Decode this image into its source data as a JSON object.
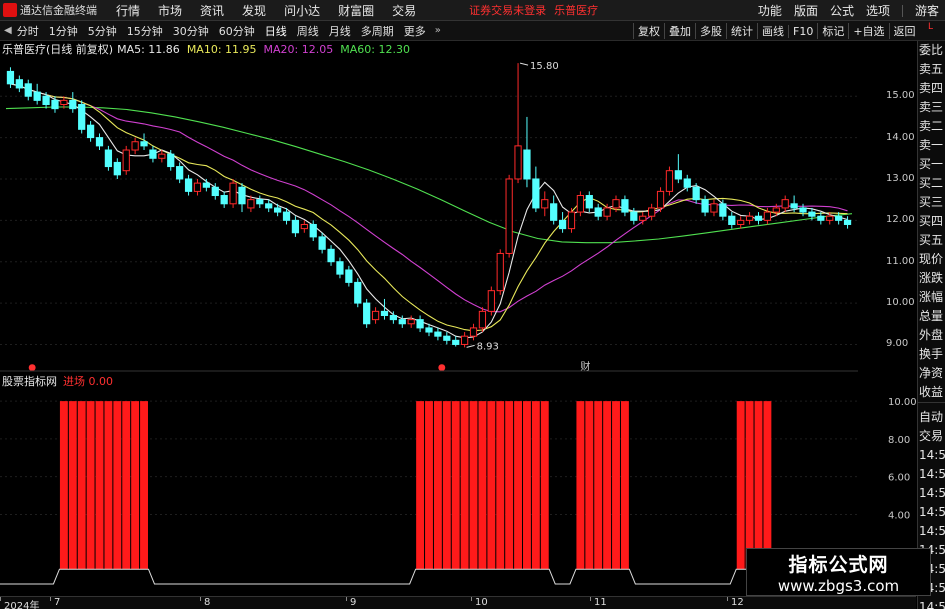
{
  "topbar": {
    "app_title": "通达信金融终端",
    "menu": [
      "行情",
      "市场",
      "资讯",
      "发现",
      "问小达",
      "财富圈",
      "交易"
    ],
    "notice": "证券交易未登录",
    "stock_link": "乐普医疗",
    "right": [
      "功能",
      "版面",
      "公式",
      "选项"
    ],
    "user": "游客"
  },
  "periodbar": {
    "periods": [
      "分时",
      "1分钟",
      "5分钟",
      "15分钟",
      "30分钟",
      "60分钟",
      "日线",
      "周线",
      "月线",
      "多周期",
      "更多"
    ],
    "tools": [
      "复权",
      "叠加",
      "多股",
      "统计",
      "画线",
      "F10",
      "标记",
      "+自选",
      "返回"
    ]
  },
  "corner_badge": "L",
  "chart_header": {
    "stock": "乐普医疗(日线 前复权)",
    "ma5": "MA5: 11.86",
    "ma10": "MA10: 11.95",
    "ma20": "MA20: 12.05",
    "ma60": "MA60: 12.30"
  },
  "ma_colors": {
    "ma5": "#e8e8e8",
    "ma10": "#e8e85a",
    "ma20": "#d040d0",
    "ma60": "#50e050"
  },
  "price_axis_labels": [
    "15.00",
    "14.00",
    "13.00",
    "12.00",
    "11.00",
    "10.00",
    "9.00"
  ],
  "annotations": {
    "high": "15.80",
    "low": "8.93",
    "marker_fin": "财"
  },
  "sub_header": {
    "name": "股票指标网",
    "label": "进场",
    "value": "0.00"
  },
  "sub_axis_labels": [
    "10.00",
    "8.00",
    "6.00",
    "4.00"
  ],
  "date_axis": [
    "2024年",
    "7",
    "8",
    "9",
    "10",
    "11",
    "12"
  ],
  "side_panel": {
    "main": [
      "委比",
      "卖五",
      "卖四",
      "卖三",
      "卖二",
      "卖一",
      "买一",
      "买二",
      "买三",
      "买四",
      "买五",
      "现价",
      "涨跌",
      "涨幅",
      "总量",
      "外盘",
      "换手",
      "净资",
      "收益"
    ],
    "sub": [
      "自动",
      "交易",
      "14:50",
      "14:50",
      "14:50",
      "14:50",
      "14:50",
      "14:50",
      "14:50",
      "14:50",
      "14:50"
    ]
  },
  "watermark": {
    "line1": "指标公式网",
    "line2": "www.zbgs3.com"
  },
  "colors": {
    "up": "#ff2a2a",
    "down": "#54ffff",
    "bar": "#ff1a1a",
    "background": "#000000"
  },
  "chart_data": {
    "type": "candlestick",
    "price_range": [
      8.6,
      15.9
    ],
    "candles": [
      [
        15.6,
        15.3,
        15.7,
        15.2
      ],
      [
        15.4,
        15.2,
        15.5,
        15.1
      ],
      [
        15.3,
        15.0,
        15.4,
        14.9
      ],
      [
        15.1,
        14.9,
        15.3,
        14.8
      ],
      [
        15.0,
        14.8,
        15.1,
        14.7
      ],
      [
        14.9,
        14.7,
        15.0,
        14.6
      ],
      [
        14.8,
        14.9,
        15.0,
        14.7
      ],
      [
        14.9,
        14.7,
        15.1,
        14.6
      ],
      [
        14.8,
        14.2,
        14.9,
        14.1
      ],
      [
        14.3,
        14.0,
        14.4,
        13.9
      ],
      [
        14.0,
        13.8,
        14.1,
        13.7
      ],
      [
        13.7,
        13.3,
        13.8,
        13.2
      ],
      [
        13.4,
        13.1,
        13.5,
        13.0
      ],
      [
        13.2,
        13.7,
        13.8,
        13.1
      ],
      [
        13.7,
        13.9,
        14.0,
        13.6
      ],
      [
        13.9,
        13.8,
        14.1,
        13.7
      ],
      [
        13.7,
        13.5,
        13.8,
        13.4
      ],
      [
        13.5,
        13.6,
        13.7,
        13.4
      ],
      [
        13.6,
        13.3,
        13.7,
        13.2
      ],
      [
        13.3,
        13.0,
        13.4,
        12.9
      ],
      [
        13.0,
        12.7,
        13.1,
        12.6
      ],
      [
        12.7,
        12.9,
        13.0,
        12.6
      ],
      [
        12.9,
        12.8,
        13.0,
        12.7
      ],
      [
        12.8,
        12.6,
        12.9,
        12.5
      ],
      [
        12.6,
        12.4,
        12.7,
        12.3
      ],
      [
        12.4,
        12.9,
        13.0,
        12.3
      ],
      [
        12.8,
        12.4,
        12.9,
        12.2
      ],
      [
        12.3,
        12.5,
        12.6,
        12.2
      ],
      [
        12.5,
        12.4,
        12.6,
        12.3
      ],
      [
        12.4,
        12.3,
        12.5,
        12.2
      ],
      [
        12.3,
        12.2,
        12.4,
        12.1
      ],
      [
        12.2,
        12.0,
        12.3,
        11.9
      ],
      [
        12.0,
        11.7,
        12.1,
        11.6
      ],
      [
        11.8,
        11.9,
        12.0,
        11.7
      ],
      [
        11.9,
        11.6,
        12.0,
        11.5
      ],
      [
        11.6,
        11.3,
        11.7,
        11.2
      ],
      [
        11.3,
        11.0,
        11.4,
        10.9
      ],
      [
        11.0,
        10.7,
        11.1,
        10.6
      ],
      [
        10.8,
        10.5,
        10.9,
        10.4
      ],
      [
        10.5,
        10.0,
        10.6,
        9.9
      ],
      [
        10.0,
        9.5,
        10.1,
        9.4
      ],
      [
        9.6,
        9.8,
        9.9,
        9.5
      ],
      [
        9.8,
        9.7,
        10.1,
        9.6
      ],
      [
        9.7,
        9.6,
        9.8,
        9.5
      ],
      [
        9.6,
        9.5,
        9.7,
        9.4
      ],
      [
        9.5,
        9.6,
        9.7,
        9.4
      ],
      [
        9.6,
        9.4,
        9.7,
        9.3
      ],
      [
        9.4,
        9.3,
        9.5,
        9.2
      ],
      [
        9.3,
        9.2,
        9.4,
        9.1
      ],
      [
        9.2,
        9.1,
        9.3,
        9.0
      ],
      [
        9.1,
        9.0,
        9.2,
        8.95
      ],
      [
        9.0,
        9.2,
        9.3,
        8.93
      ],
      [
        9.2,
        9.4,
        9.5,
        9.1
      ],
      [
        9.4,
        9.8,
        9.9,
        9.3
      ],
      [
        9.8,
        10.3,
        10.4,
        9.7
      ],
      [
        10.3,
        11.2,
        11.3,
        10.2
      ],
      [
        11.2,
        13.0,
        13.1,
        11.1
      ],
      [
        13.0,
        13.8,
        15.8,
        12.9
      ],
      [
        13.7,
        13.0,
        14.5,
        12.8
      ],
      [
        13.0,
        12.3,
        13.3,
        12.2
      ],
      [
        12.3,
        12.5,
        12.7,
        12.1
      ],
      [
        12.4,
        12.0,
        12.6,
        11.9
      ],
      [
        12.0,
        11.8,
        12.2,
        11.7
      ],
      [
        11.8,
        12.2,
        12.3,
        11.7
      ],
      [
        12.2,
        12.6,
        12.7,
        12.1
      ],
      [
        12.6,
        12.3,
        12.7,
        12.2
      ],
      [
        12.3,
        12.1,
        12.4,
        12.0
      ],
      [
        12.1,
        12.3,
        12.4,
        12.0
      ],
      [
        12.3,
        12.5,
        12.6,
        12.2
      ],
      [
        12.5,
        12.2,
        12.6,
        12.1
      ],
      [
        12.2,
        12.0,
        12.3,
        11.9
      ],
      [
        12.0,
        12.1,
        12.2,
        11.9
      ],
      [
        12.1,
        12.3,
        12.4,
        12.0
      ],
      [
        12.3,
        12.7,
        12.8,
        12.2
      ],
      [
        12.7,
        13.2,
        13.3,
        12.6
      ],
      [
        13.2,
        13.0,
        13.6,
        12.9
      ],
      [
        13.0,
        12.8,
        13.1,
        12.7
      ],
      [
        12.8,
        12.5,
        12.9,
        12.4
      ],
      [
        12.5,
        12.2,
        12.6,
        12.1
      ],
      [
        12.2,
        12.4,
        12.5,
        12.1
      ],
      [
        12.4,
        12.1,
        12.5,
        12.0
      ],
      [
        12.1,
        11.9,
        12.2,
        11.8
      ],
      [
        11.9,
        12.0,
        12.1,
        11.8
      ],
      [
        12.0,
        12.1,
        12.2,
        11.9
      ],
      [
        12.1,
        12.0,
        12.2,
        11.9
      ],
      [
        12.0,
        12.2,
        12.3,
        11.9
      ],
      [
        12.2,
        12.3,
        12.4,
        12.1
      ],
      [
        12.3,
        12.5,
        12.6,
        12.2
      ],
      [
        12.4,
        12.3,
        12.6,
        12.2
      ],
      [
        12.3,
        12.2,
        12.4,
        12.1
      ],
      [
        12.2,
        12.1,
        12.3,
        12.0
      ],
      [
        12.1,
        12.0,
        12.2,
        11.9
      ],
      [
        12.0,
        12.1,
        12.2,
        11.9
      ],
      [
        12.1,
        12.0,
        12.2,
        11.9
      ],
      [
        12.0,
        11.9,
        12.1,
        11.8
      ]
    ],
    "ma60": [
      14.7,
      14.72,
      14.74,
      14.74,
      14.72,
      14.68,
      14.6,
      14.5,
      14.38,
      14.25,
      14.1,
      13.95,
      13.78,
      13.6,
      13.42,
      13.22,
      13.0,
      12.76,
      12.5,
      12.22,
      11.95,
      11.72,
      11.56,
      11.48,
      11.46,
      11.46,
      11.5,
      11.55,
      11.62,
      11.7,
      11.78,
      11.86,
      11.94,
      12.02,
      12.1,
      12.16
    ],
    "signal_segments": [
      [
        6,
        15
      ],
      [
        46,
        60
      ],
      [
        64,
        69
      ],
      [
        82,
        85
      ]
    ],
    "signal_value": 10.0,
    "signal_range": [
      0,
      10.8
    ]
  }
}
